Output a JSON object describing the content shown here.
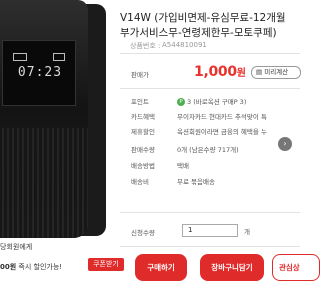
{
  "product": {
    "title_line1": "V14W (가입비면제-유심무료-12개월",
    "title_line2": "부가서비스무-연령제한무-모토쿠페)",
    "code_label": "상품번호 :",
    "code_value": "A544810091",
    "phone_screen_time": "07:23"
  },
  "pricing": {
    "label": "판매가",
    "price": "1,000",
    "currency": "원",
    "calc_button": "미리계산"
  },
  "details": {
    "point_label": "포인트",
    "point_value": "3",
    "point_note": "(바로옥션 구매P 3)",
    "card_label": "카드혜택",
    "card_value": "무이자카드 현대카드 추석맞이 특",
    "partner_label": "제휴할인",
    "partner_value": "옥션회원이라면 금융의 혜택을 누",
    "stock_label": "판매수량",
    "stock_value": "0개 (남은수량 717개)",
    "shipping_method_label": "배송방법",
    "shipping_method_value": "택배",
    "shipping_fee_label": "배송비",
    "shipping_fee_value": "무료 묶음배송"
  },
  "order": {
    "qty_label": "신청수량",
    "qty_value": "1",
    "qty_unit": "개"
  },
  "actions": {
    "buy": "구매하기",
    "cart": "장바구니담기",
    "fav": "관심상"
  },
  "promo": {
    "line1": "당회원에게",
    "line2_amount": "00원",
    "line2_text": "즉시 할인가능!",
    "coupon_button": "쿠폰받기"
  },
  "colors": {
    "accent": "#e02b2b",
    "price": "#e8322c",
    "point_badge": "#4caf50"
  }
}
